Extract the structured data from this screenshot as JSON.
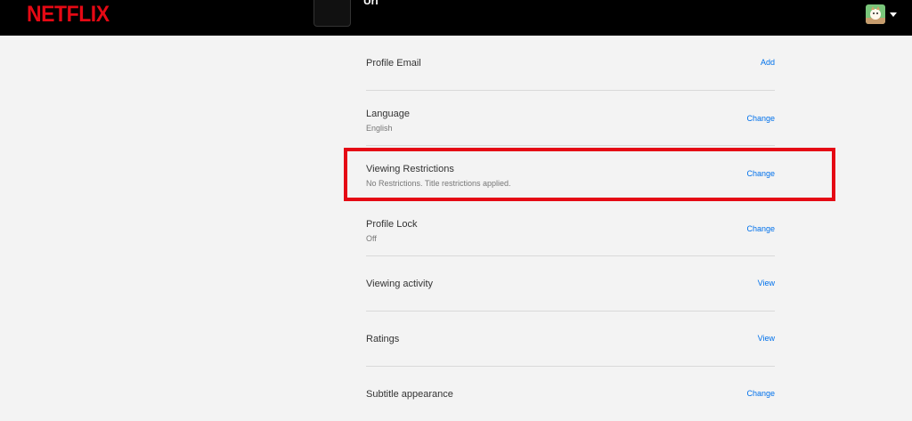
{
  "header": {
    "logo": "NETFLIX",
    "profile_name": "Uri",
    "profile_subtitle": "",
    "top_action": "",
    "avatar_icon": "profile-avatar-icon",
    "menu_icon": "caret-down-icon"
  },
  "settings": [
    {
      "title": "Profile Email",
      "subtitle": "",
      "action": "Add"
    },
    {
      "title": "Language",
      "subtitle": "English",
      "action": "Change"
    },
    {
      "title": "Viewing Restrictions",
      "subtitle": "No Restrictions. Title restrictions applied.",
      "action": "Change"
    },
    {
      "title": "Profile Lock",
      "subtitle": "Off",
      "action": "Change"
    },
    {
      "title": "Viewing activity",
      "subtitle": "",
      "action": "View"
    },
    {
      "title": "Ratings",
      "subtitle": "",
      "action": "View"
    },
    {
      "title": "Subtitle appearance",
      "subtitle": "",
      "action": "Change"
    }
  ],
  "colors": {
    "brand": "#e50914",
    "link": "#0071eb",
    "background": "#f3f3f3",
    "header": "#000000"
  }
}
